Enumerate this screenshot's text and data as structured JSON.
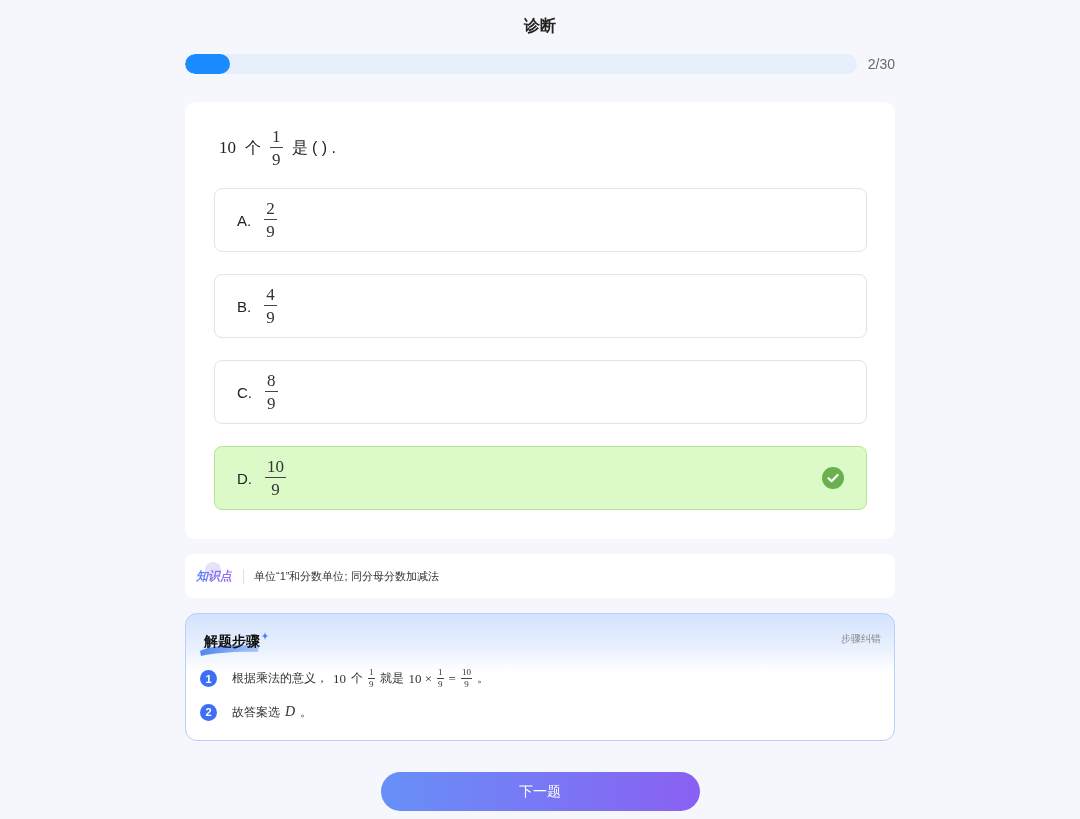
{
  "header": {
    "title": "诊断"
  },
  "progress": {
    "level": 0.067,
    "reading": "2/30"
  },
  "question": {
    "stem": [
      {
        "kind": "math",
        "text": "10"
      },
      {
        "kind": "text",
        "text": "个"
      },
      {
        "kind": "fraction",
        "numerator": "1",
        "denominator": "9"
      },
      {
        "kind": "text",
        "text": "是 ( ) ."
      }
    ],
    "options": [
      {
        "letter": "A.",
        "answer": {
          "numerator": "2",
          "denominator": "9"
        },
        "selected": false,
        "correct": false
      },
      {
        "letter": "B.",
        "answer": {
          "numerator": "4",
          "denominator": "9"
        },
        "selected": false,
        "correct": false
      },
      {
        "letter": "C.",
        "answer": {
          "numerator": "8",
          "denominator": "9"
        },
        "selected": false,
        "correct": false
      },
      {
        "letter": "D.",
        "answer": {
          "numerator": "10",
          "denominator": "9"
        },
        "selected": true,
        "correct": true
      }
    ]
  },
  "knowledge_point": {
    "label": "知识点",
    "text": "单位“1”和分数单位; 同分母分数加减法"
  },
  "solution": {
    "title": "解题步骤",
    "action": "步骤纠错",
    "steps": [
      {
        "number": "1",
        "content": [
          {
            "kind": "text",
            "text": "根据乘法的意义，"
          },
          {
            "kind": "math",
            "text": "10"
          },
          {
            "kind": "text",
            "text": "个"
          },
          {
            "kind": "fraction",
            "numerator": "1",
            "denominator": "9"
          },
          {
            "kind": "text",
            "text": "就是"
          },
          {
            "kind": "math",
            "text": "10 ×"
          },
          {
            "kind": "fraction",
            "numerator": "1",
            "denominator": "9"
          },
          {
            "kind": "math",
            "text": "="
          },
          {
            "kind": "fraction",
            "numerator": "10",
            "denominator": "9"
          },
          {
            "kind": "text",
            "text": "。"
          }
        ]
      },
      {
        "number": "2",
        "content": [
          {
            "kind": "text",
            "text": "故答案选"
          },
          {
            "kind": "variable",
            "text": "D"
          },
          {
            "kind": "text",
            "text": "。"
          }
        ]
      }
    ]
  },
  "next_button": {
    "label": "下一题"
  }
}
